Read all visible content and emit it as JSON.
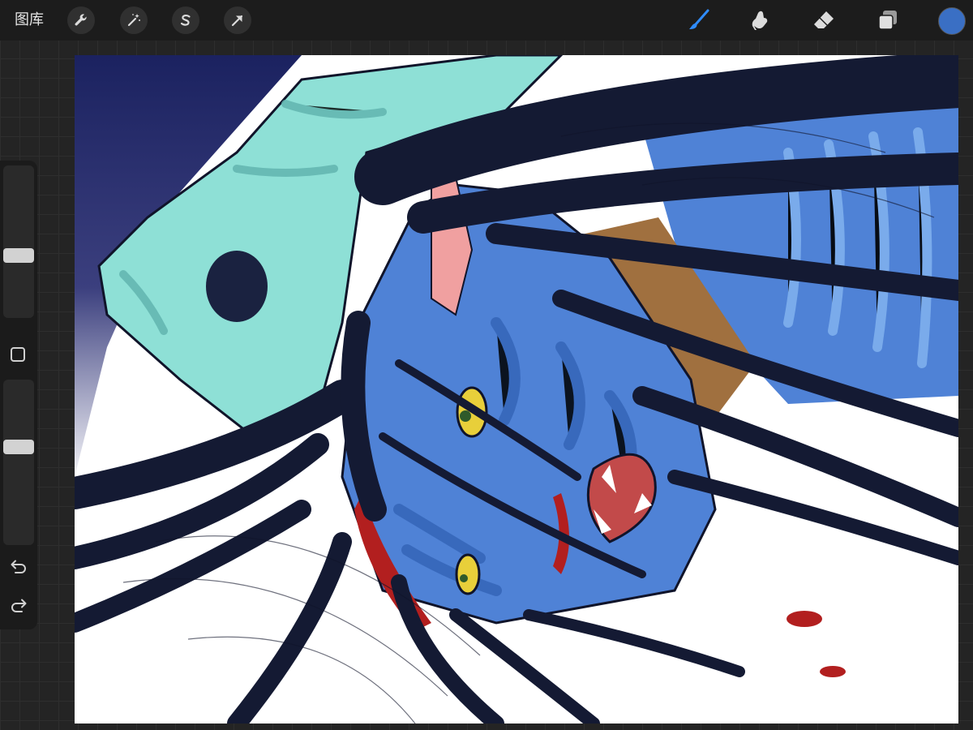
{
  "toolbar": {
    "gallery_label": "图库",
    "left_tools": [
      "wrench-icon",
      "magic-wand-icon",
      "selection-s-icon",
      "transform-arrow-icon"
    ],
    "right_tools": [
      "brush-icon",
      "smudge-icon",
      "eraser-icon",
      "layers-icon"
    ],
    "current_color": "#3a6fc4"
  },
  "sidebar": {
    "brush_size_level": 0.4,
    "opacity_level": 0.6
  },
  "colors": {
    "background": "#242424",
    "topbar": "#1c1c1c",
    "skin_blue": "#4f82d6",
    "teal_skin": "#8ee0d6",
    "hair": "#141a33",
    "eye_yellow": "#e8cf3a",
    "blood": "#b21f1f",
    "night_sky": "#1e2a66"
  }
}
